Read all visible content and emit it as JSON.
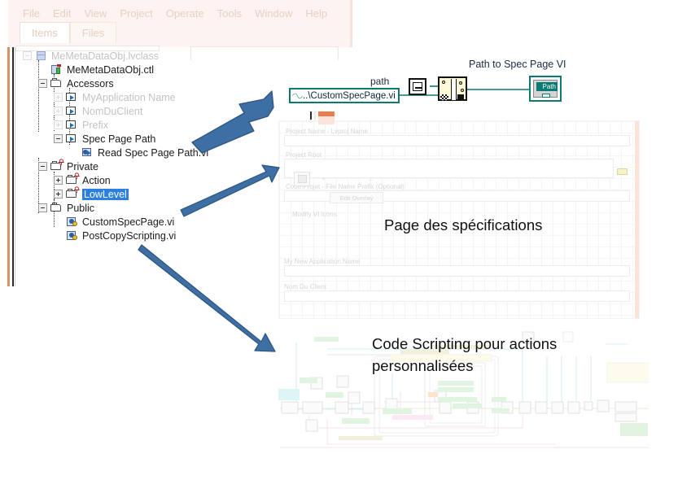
{
  "window": {
    "menubar": [
      "File",
      "Edit",
      "View",
      "Project",
      "Operate",
      "Tools",
      "Window",
      "Help"
    ],
    "tabs": [
      {
        "label": "Items",
        "active": true
      },
      {
        "label": "Files",
        "active": false
      }
    ]
  },
  "tree": {
    "items": [
      {
        "label": "MeMetaDataObj.lvclass",
        "indent": 0,
        "icon": "cube-icon",
        "expander": "minus",
        "dim": true
      },
      {
        "label": "MeMetaDataObj.ctl",
        "indent": 1,
        "icon": "control-icon",
        "expander": "none",
        "dim": false
      },
      {
        "label": "Accessors",
        "indent": 1,
        "icon": "folder-icon",
        "expander": "minus",
        "dim": false
      },
      {
        "label": "MyApplication Name",
        "indent": 2,
        "icon": "accessor-icon",
        "expander": "plus",
        "dim": true
      },
      {
        "label": "NomDuClient",
        "indent": 2,
        "icon": "accessor-icon",
        "expander": "plus",
        "dim": true
      },
      {
        "label": "Prefix",
        "indent": 2,
        "icon": "accessor-icon",
        "expander": "plus",
        "dim": true
      },
      {
        "label": "Spec Page Path",
        "indent": 2,
        "icon": "accessor-icon",
        "expander": "minus",
        "dim": false
      },
      {
        "label": "Read Spec Page Path.vi",
        "indent": 3,
        "icon": "vi-accessor-icon",
        "expander": "none",
        "dim": false
      },
      {
        "label": "Private",
        "indent": 1,
        "icon": "folder-locked-icon",
        "expander": "minus",
        "dim": false
      },
      {
        "label": "Action",
        "indent": 2,
        "icon": "folder-locked-icon",
        "expander": "plus",
        "dim": false
      },
      {
        "label": "LowLevel",
        "indent": 2,
        "icon": "folder-locked-icon",
        "expander": "plus",
        "dim": false,
        "selected": true
      },
      {
        "label": "Public",
        "indent": 1,
        "icon": "folder-icon",
        "expander": "minus",
        "dim": false
      },
      {
        "label": "CustomSpecPage.vi",
        "indent": 2,
        "icon": "vi-icon",
        "expander": "none",
        "dim": false
      },
      {
        "label": "PostCopyScripting.vi",
        "indent": 2,
        "icon": "vi-icon",
        "expander": "none",
        "dim": false
      }
    ]
  },
  "block_diagram": {
    "title": "Path to Spec Page VI",
    "wire_label": "path",
    "constant_value": "..\\CustomSpecPage.vi",
    "terminal_label": "Path",
    "nodes": [
      {
        "name": "current-vi-path-node"
      },
      {
        "name": "strip-build-path-node"
      }
    ]
  },
  "spec_page": {
    "fields": [
      {
        "label": "Project Name - Lvproj Name"
      },
      {
        "label": "Project Root"
      },
      {
        "label": "Code Projet - File Name Prefix (Optional)"
      },
      {
        "label": "Modify VI Icons"
      },
      {
        "label": "My New Application Name"
      },
      {
        "label": "Nom Du Client"
      }
    ],
    "edit_overlay_button": "Edit Overlay",
    "plus_symbol": "+",
    "equals_symbol": "="
  },
  "annotations": {
    "spec_page_caption": "Page des spécifications",
    "code_caption": "Code Scripting pour actions personnalisées"
  },
  "colors": {
    "arrow_fill": "#3d6fa5",
    "arrow_stroke": "#2e5680",
    "selection_blue": "#2a7fe0",
    "labview_teal": "#0a7a72",
    "node_yellow": "#fffbd9",
    "salmon_rule": "#dc8f62"
  }
}
